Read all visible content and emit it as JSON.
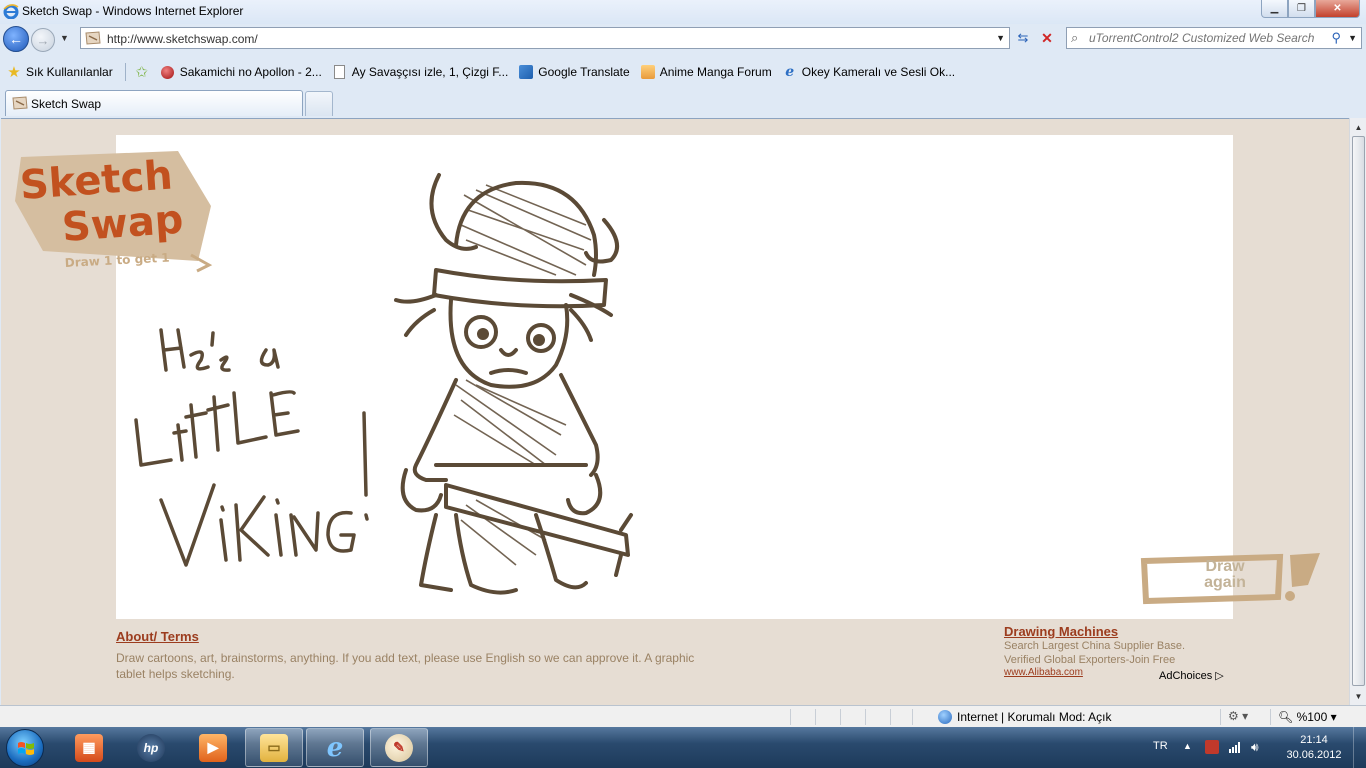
{
  "window": {
    "title": "Sketch Swap - Windows Internet Explorer"
  },
  "navbar": {
    "url": "http://www.sketchswap.com/",
    "search_placeholder": "uTorrentControl2 Customized Web Search"
  },
  "favorites": {
    "label": "Sık Kullanılanlar",
    "items": [
      {
        "label": "Sakamichi no Apollon - 2...",
        "icon": "red-ball-icon"
      },
      {
        "label": "Ay Savaşçısı izle, 1, Çizgi F...",
        "icon": "page-icon"
      },
      {
        "label": "Google Translate",
        "icon": "translate-icon"
      },
      {
        "label": "Anime Manga Forum",
        "icon": "anime-icon"
      },
      {
        "label": "Okey  Kameralı ve Sesli Ok...",
        "icon": "ie-icon"
      }
    ]
  },
  "tabs": [
    {
      "label": "Sketch Swap"
    }
  ],
  "page": {
    "logo": {
      "line1": "Sketch",
      "line2": "Swap",
      "tagline": "Draw 1 to get 1"
    },
    "drawing": {
      "handwritten_text": [
        "He's a",
        "Little",
        "Viking!"
      ]
    },
    "draw_again": {
      "line1": "Draw",
      "line2": "again"
    },
    "about": {
      "link": "About/ Terms",
      "text": "Draw cartoons, art, brainstorms, anything. If you add text, please use English so we can approve it. A graphic tablet helps sketching."
    },
    "ad": {
      "title": "Drawing Machines",
      "line1": "Search Largest China Supplier Base.",
      "line2": "Verified Global Exporters-Join Free",
      "url": "www.Alibaba.com",
      "choices": "AdChoices"
    }
  },
  "statusbar": {
    "zone": "Internet | Korumalı Mod: Açık",
    "zoom": "%100"
  },
  "taskbar": {
    "lang": "TR",
    "time": "21:14",
    "date": "30.06.2012"
  },
  "colors": {
    "page_bg": "#e6ddd3",
    "link": "#9c3c1e",
    "text_muted": "#9a8264",
    "logo_brown": "#c2511f",
    "logo_tan": "#c9ab84",
    "sketch_ink": "#5b4a36"
  }
}
